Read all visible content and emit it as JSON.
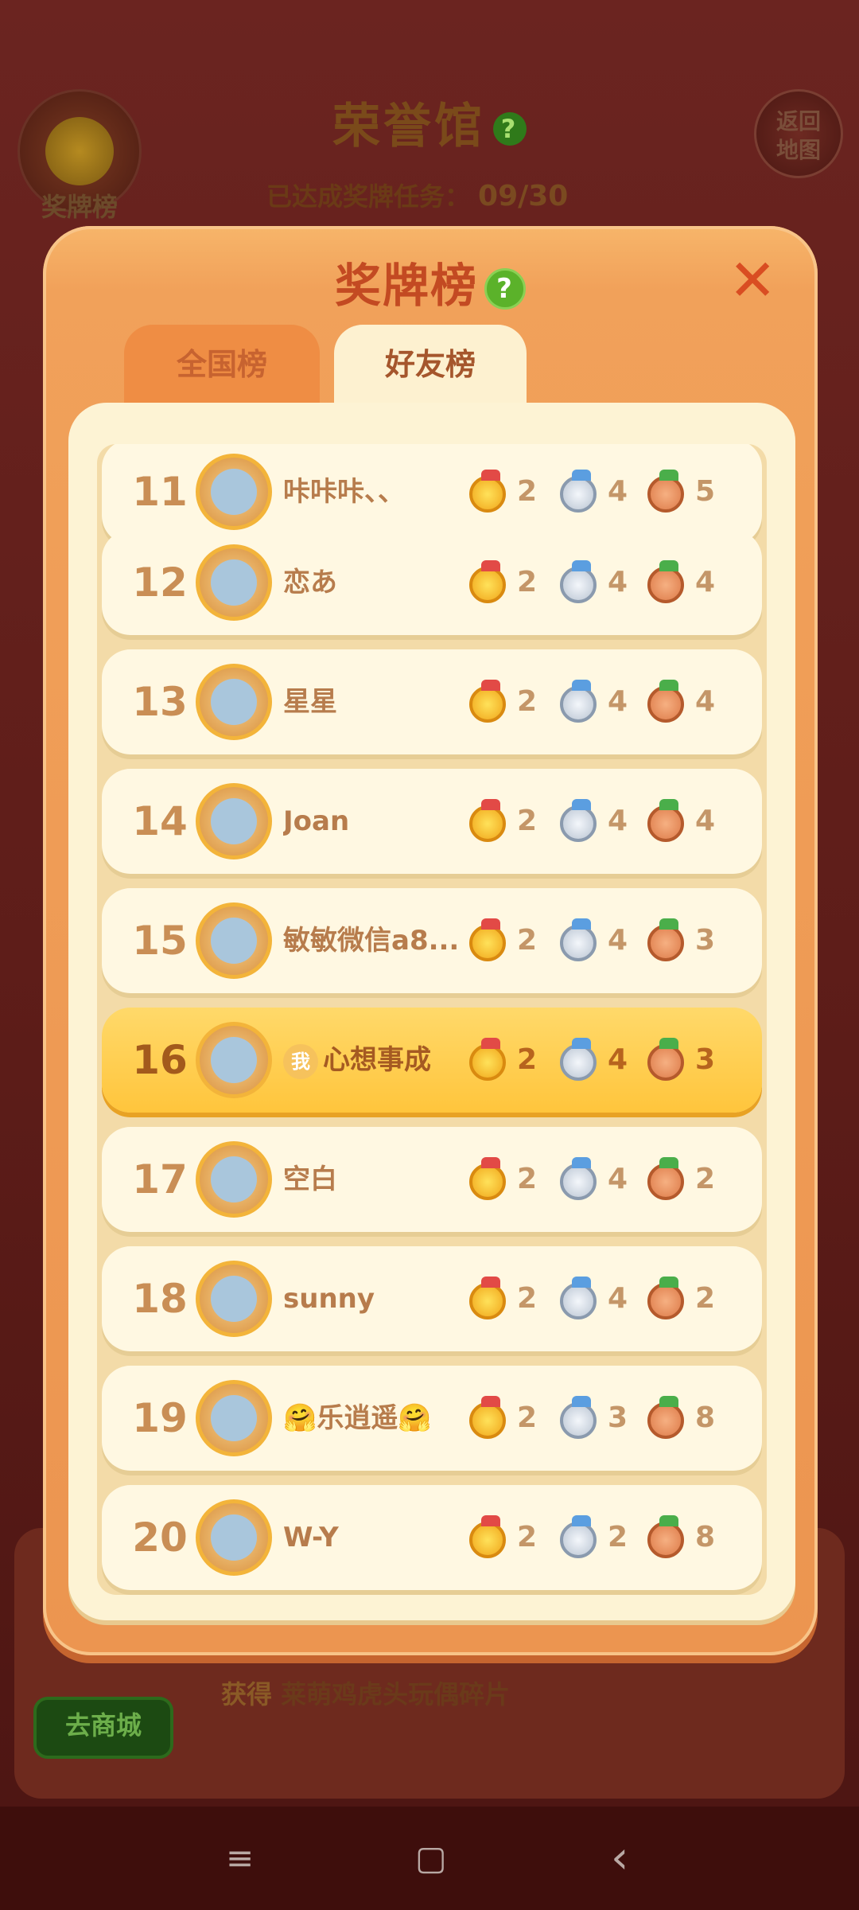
{
  "background": {
    "title": "荣誉馆",
    "progress_label": "已达成奖牌任务：",
    "progress_value": "09/30",
    "medal_button_label": "奖牌榜",
    "back_button_line1": "返回",
    "back_button_line2": "地图",
    "shop_button_label": "去商城",
    "reward_prefix": "获得",
    "reward_item": "莱萌鸡虎头玩偶碎片"
  },
  "modal": {
    "title": "奖牌榜",
    "help_icon": "?",
    "close_icon": "✕",
    "tabs": [
      {
        "label": "全国榜",
        "active": false
      },
      {
        "label": "好友榜",
        "active": true
      }
    ]
  },
  "leaderboard": {
    "rows": [
      {
        "rank": "11",
        "name": "咔咔咔、、",
        "gold": "2",
        "silver": "4",
        "bronze": "5",
        "is_me": false
      },
      {
        "rank": "12",
        "name": "恋あ",
        "gold": "2",
        "silver": "4",
        "bronze": "4",
        "is_me": false
      },
      {
        "rank": "13",
        "name": "星星",
        "gold": "2",
        "silver": "4",
        "bronze": "4",
        "is_me": false
      },
      {
        "rank": "14",
        "name": "Joan",
        "gold": "2",
        "silver": "4",
        "bronze": "4",
        "is_me": false
      },
      {
        "rank": "15",
        "name": "敏敏微信a8...",
        "gold": "2",
        "silver": "4",
        "bronze": "3",
        "is_me": false
      },
      {
        "rank": "16",
        "name": "心想事成",
        "me_tag": "我",
        "gold": "2",
        "silver": "4",
        "bronze": "3",
        "is_me": true
      },
      {
        "rank": "17",
        "name": "空白",
        "gold": "2",
        "silver": "4",
        "bronze": "2",
        "is_me": false
      },
      {
        "rank": "18",
        "name": "sunny",
        "gold": "2",
        "silver": "4",
        "bronze": "2",
        "is_me": false
      },
      {
        "rank": "19",
        "name": "🤗乐逍遥🤗",
        "gold": "2",
        "silver": "3",
        "bronze": "8",
        "is_me": false
      },
      {
        "rank": "20",
        "name": "W-Y",
        "gold": "2",
        "silver": "2",
        "bronze": "8",
        "is_me": false
      }
    ]
  },
  "navbar": {
    "menu_icon": "≡",
    "home_icon": "▢",
    "back_icon": "‹"
  }
}
